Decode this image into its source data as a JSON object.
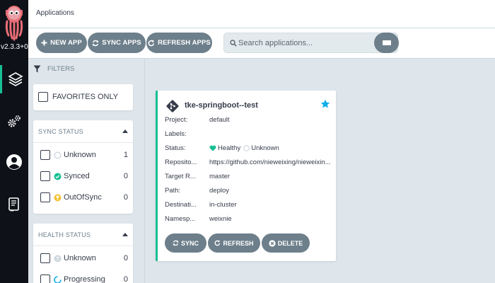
{
  "sidebar": {
    "version": "v2.3.3+0",
    "nav": [
      "applications",
      "settings",
      "user-info",
      "documentation"
    ]
  },
  "header": {
    "title": "Applications"
  },
  "toolbar": {
    "new_app": "NEW APP",
    "sync_apps": "SYNC APPS",
    "refresh_apps": "REFRESH APPS",
    "search_placeholder": "Search applications...",
    "search_shortcut": "/"
  },
  "filters": {
    "title": "FILTERS",
    "favorites_label": "FAVORITES ONLY",
    "sync_status": {
      "title": "SYNC STATUS",
      "items": [
        {
          "label": "Unknown",
          "count": "1",
          "icon": "circle-outline-icon"
        },
        {
          "label": "Synced",
          "count": "0",
          "icon": "check-circle-icon"
        },
        {
          "label": "OutOfSync",
          "count": "0",
          "icon": "arrow-up-circle-icon"
        }
      ]
    },
    "health_status": {
      "title": "HEALTH STATUS",
      "items": [
        {
          "label": "Unknown",
          "count": "0",
          "icon": "question-circle-icon"
        },
        {
          "label": "Progressing",
          "count": "0",
          "icon": "spinner-icon"
        }
      ]
    }
  },
  "app_card": {
    "name": "tke-springboot--test",
    "fields": [
      {
        "key": "Project:",
        "value": "default"
      },
      {
        "key": "Labels:",
        "value": ""
      },
      {
        "key": "Status:",
        "health": "Healthy",
        "sync": "Unknown"
      },
      {
        "key": "Reposito...",
        "value": "https://github.com/nieweixing/nieweixin..."
      },
      {
        "key": "Target R...",
        "value": "master"
      },
      {
        "key": "Path:",
        "value": "deploy"
      },
      {
        "key": "Destinati...",
        "value": "in-cluster"
      },
      {
        "key": "Namesp...",
        "value": "weixnie"
      }
    ],
    "buttons": {
      "sync": "SYNC",
      "refresh": "REFRESH",
      "delete": "DELETE"
    }
  },
  "colors": {
    "rail": "#0e1118",
    "accent": "#18be94",
    "button": "#6d7f8b",
    "star": "#0dadea",
    "sync_yellow": "#f4c030"
  }
}
